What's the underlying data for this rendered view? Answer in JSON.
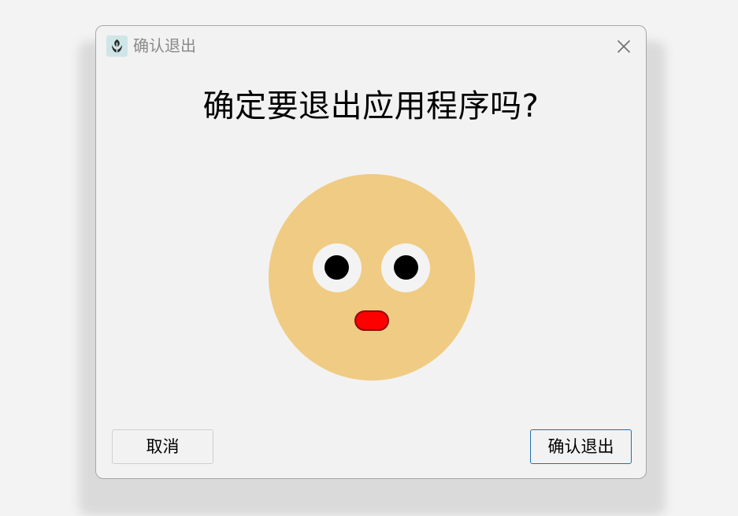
{
  "window": {
    "title": "确认退出",
    "app_icon": "app-logo-icon",
    "close_icon": "close-icon"
  },
  "dialog": {
    "message": "确定要退出应用程序吗?",
    "illustration": "surprised-face"
  },
  "buttons": {
    "cancel_label": "取消",
    "confirm_label": "确认退出"
  },
  "colors": {
    "face": "#f0cb83",
    "mouth": "#fe0000",
    "confirm_border": "#1f70b5",
    "app_icon_bg": "#cfe6e8"
  }
}
